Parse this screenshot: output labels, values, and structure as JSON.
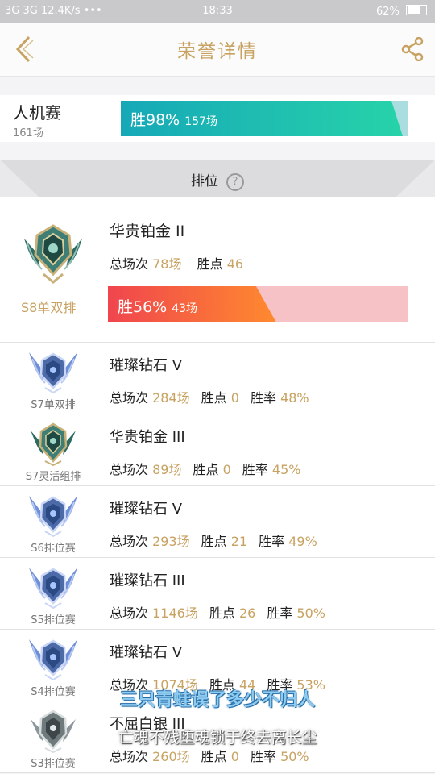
{
  "status_bar": {
    "left": "3G 3G 12.4K/s •••",
    "time": "18:33",
    "battery": "62%"
  },
  "header": {
    "title": "荣誉详情"
  },
  "ai_match": {
    "title": "人机赛",
    "count": "161场",
    "win_rate_label": "胜98%",
    "wins": "157场",
    "win_rate": 0.98,
    "fill_color": "#1fc2b0",
    "track_color": "#a9dde0"
  },
  "section": {
    "title": "排位",
    "help_icon": "question-circle-icon"
  },
  "current_season": {
    "season": "S8单双排",
    "tier": "华贵铂金 II",
    "total_label": "总场次",
    "total": "78场",
    "points_label": "胜点",
    "points": "46",
    "win_rate_label": "胜56%",
    "wins": "43场",
    "win_rate": 0.56,
    "fill_color": "#f0454e",
    "track_color": "#f6c2c6"
  },
  "stat_labels": {
    "total": "总场次",
    "points": "胜点",
    "rate": "胜率"
  },
  "seasons": [
    {
      "season": "S7单双排",
      "tier": "璀璨钻石 V",
      "total": "284场",
      "points": "0",
      "rate": "48%",
      "emblem": "diamond"
    },
    {
      "season": "S7灵活组排",
      "tier": "华贵铂金 III",
      "total": "89场",
      "points": "0",
      "rate": "45%",
      "emblem": "platinum"
    },
    {
      "season": "S6排位赛",
      "tier": "璀璨钻石 V",
      "total": "293场",
      "points": "21",
      "rate": "49%",
      "emblem": "diamond"
    },
    {
      "season": "S5排位赛",
      "tier": "璀璨钻石 III",
      "total": "1146场",
      "points": "26",
      "rate": "50%",
      "emblem": "diamond"
    },
    {
      "season": "S4排位赛",
      "tier": "璀璨钻石 V",
      "total": "1074场",
      "points": "44",
      "rate": "53%",
      "emblem": "diamond"
    },
    {
      "season": "S3排位赛",
      "tier": "不屈白银 III",
      "total": "260场",
      "points": "0",
      "rate": "50%",
      "emblem": "silver"
    }
  ],
  "overlay": {
    "line1": "三只青蛙误了多少不归人",
    "line2": "亡魂不残堕魂锁于终去离长尘"
  },
  "colors": {
    "accent_gold": "#c8a261",
    "win_teal": "#1fc2b0",
    "win_red": "#f0454e"
  }
}
